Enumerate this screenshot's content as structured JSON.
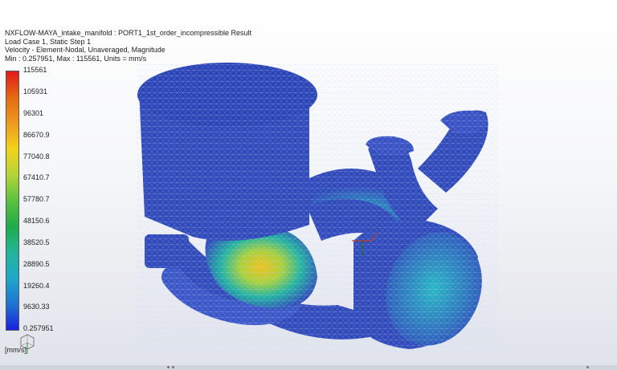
{
  "result_header": {
    "line1": "NXFLOW-MAYA_intake_manifold : PORT1_1st_order_incompressible Result",
    "line2": "Load Case 1, Static Step 1",
    "line3": "Velocity - Element-Nodal, Unaveraged, Magnitude",
    "line4": "Min : 0.257951, Max : 115561, Units = mm/s"
  },
  "legend": {
    "labels": [
      "115561",
      "105931",
      "96301",
      "86670.9",
      "77040.8",
      "67410.7",
      "57780.7",
      "48150.6",
      "38520.5",
      "28890.5",
      "19260.4",
      "9630.33",
      "0.257951"
    ],
    "units": "[mm/s]"
  },
  "colors": {
    "mesh_blue": "#2f49b9",
    "max_red": "#e31a1c",
    "min_blue": "#1a20e0"
  }
}
